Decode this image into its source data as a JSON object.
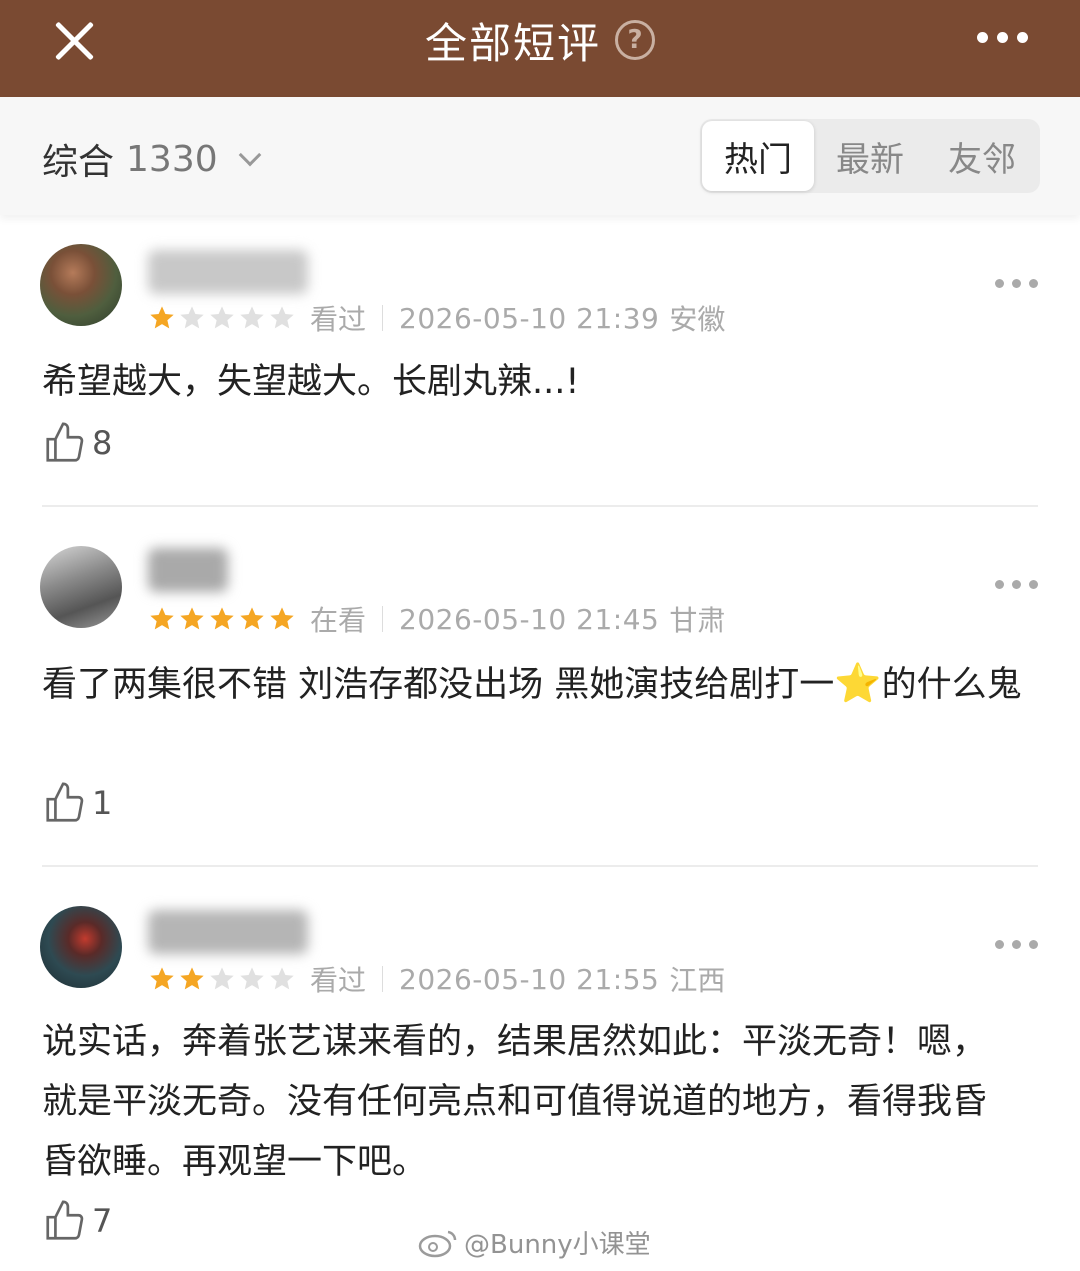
{
  "header": {
    "title": "全部短评",
    "help_glyph": "?",
    "close_icon": "close-icon",
    "more_icon": "more-horizontal-icon",
    "bg_color": "#7a4a32"
  },
  "filter": {
    "sort_label": "综合",
    "count": "1330",
    "tabs": [
      {
        "label": "热门",
        "active": true
      },
      {
        "label": "最新",
        "active": false
      },
      {
        "label": "友邻",
        "active": false
      }
    ]
  },
  "reviews": [
    {
      "rating": 1,
      "status": "看过",
      "date": "2026-05-10 21:39",
      "location": "安徽",
      "content": "希望越大，失望越大。长剧丸辣...!",
      "likes": "8"
    },
    {
      "rating": 5,
      "status": "在看",
      "date": "2026-05-10 21:45",
      "location": "甘肃",
      "content_before_emoji": "看了两集很不错 刘浩存都没出场 黑她演技给剧打一",
      "content_after_emoji": "的什么鬼",
      "emoji": "⭐",
      "likes": "1"
    },
    {
      "rating": 2,
      "status": "看过",
      "date": "2026-05-10 21:55",
      "location": "江西",
      "content": "说实话，奔着张艺谋来看的，结果居然如此：平淡无奇！嗯，就是平淡无奇。没有任何亮点和可值得说道的地方，看得我昏昏欲睡。再观望一下吧。",
      "likes": "7"
    }
  ],
  "watermark": "@Bunny小课堂",
  "colors": {
    "star_filled": "#f5a623",
    "star_empty": "#e0e0e0",
    "meta_text": "#aaaaaa"
  }
}
